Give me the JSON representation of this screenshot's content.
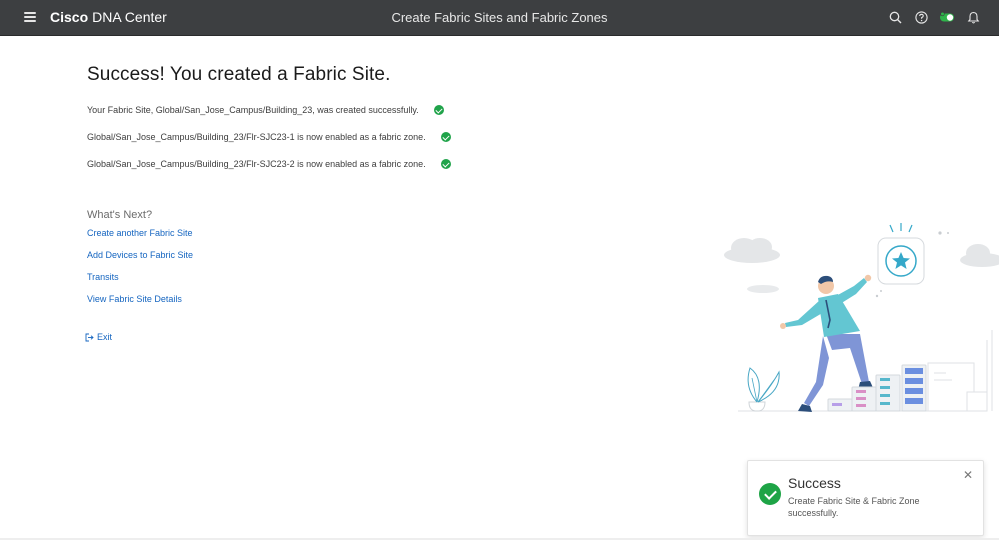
{
  "header": {
    "brand_bold": "Cisco",
    "brand_rest": "DNA Center",
    "page_heading": "Create Fabric Sites and Fabric Zones",
    "icons": [
      "search-icon",
      "help-icon",
      "status-toggle-icon",
      "notifications-icon"
    ]
  },
  "main": {
    "title": "Success! You created a Fabric Site.",
    "messages": [
      "Your Fabric Site, Global/San_Jose_Campus/Building_23, was created successfully.",
      "Global/San_Jose_Campus/Building_23/Flr-SJC23-1 is now enabled as a fabric zone.",
      "Global/San_Jose_Campus/Building_23/Flr-SJC23-2 is now enabled as a fabric zone."
    ],
    "whats_next_title": "What's Next?",
    "links": [
      "Create another Fabric Site",
      "Add Devices to Fabric Site",
      "Transits",
      "View Fabric Site Details"
    ],
    "exit_label": "Exit"
  },
  "toast": {
    "title": "Success",
    "message": "Create Fabric Site & Fabric Zone successfully."
  },
  "colors": {
    "header_bg": "#3d3f41",
    "success_green": "#20a34a",
    "link_blue": "#1565c0"
  }
}
